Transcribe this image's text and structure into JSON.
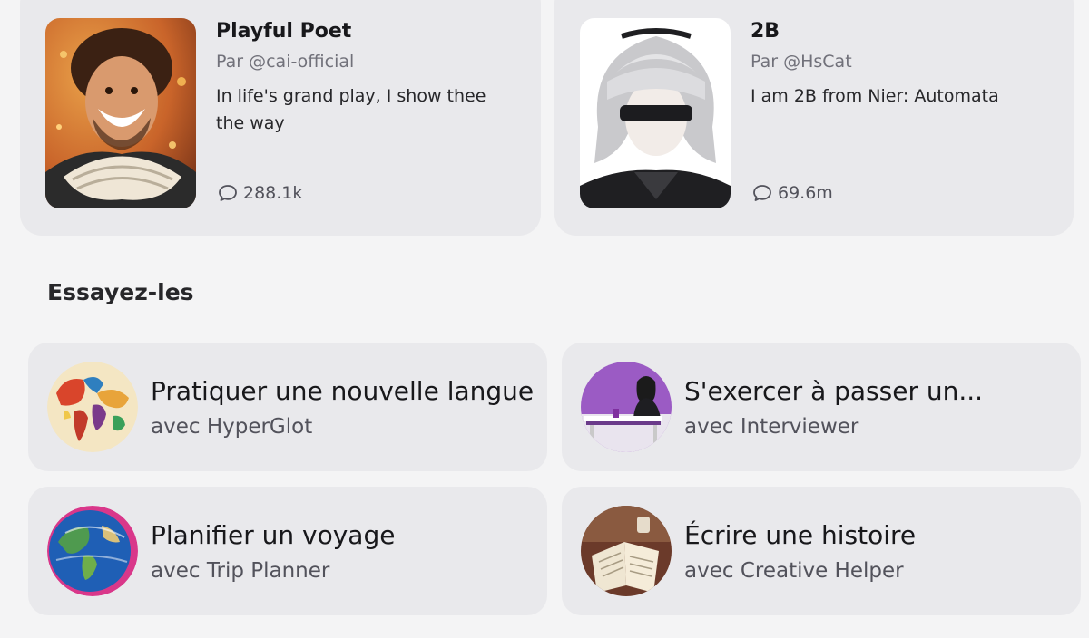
{
  "characters": [
    {
      "name": "Playful Poet",
      "author": "Par @cai-official",
      "description": "In life's grand play, I show thee the way",
      "chats": "288.1k"
    },
    {
      "name": "2B",
      "author": "Par @HsCat",
      "description": "I am 2B from Nier: Automata",
      "chats": "69.6m"
    }
  ],
  "section": {
    "title": "Essayez-les"
  },
  "try_items": [
    {
      "title": "Pratiquer une nouvelle langue",
      "subtitle": "avec HyperGlot"
    },
    {
      "title": "S'exercer à passer un...",
      "subtitle": "avec Interviewer"
    },
    {
      "title": "Planifier un voyage",
      "subtitle": "avec Trip Planner"
    },
    {
      "title": "Écrire une histoire",
      "subtitle": "avec Creative Helper"
    }
  ],
  "colors": {
    "background": "#f4f4f5",
    "card": "#e9e9ec",
    "muted_text": "#71717a"
  },
  "icons": {
    "chat_count": "chat-bubble-icon"
  }
}
